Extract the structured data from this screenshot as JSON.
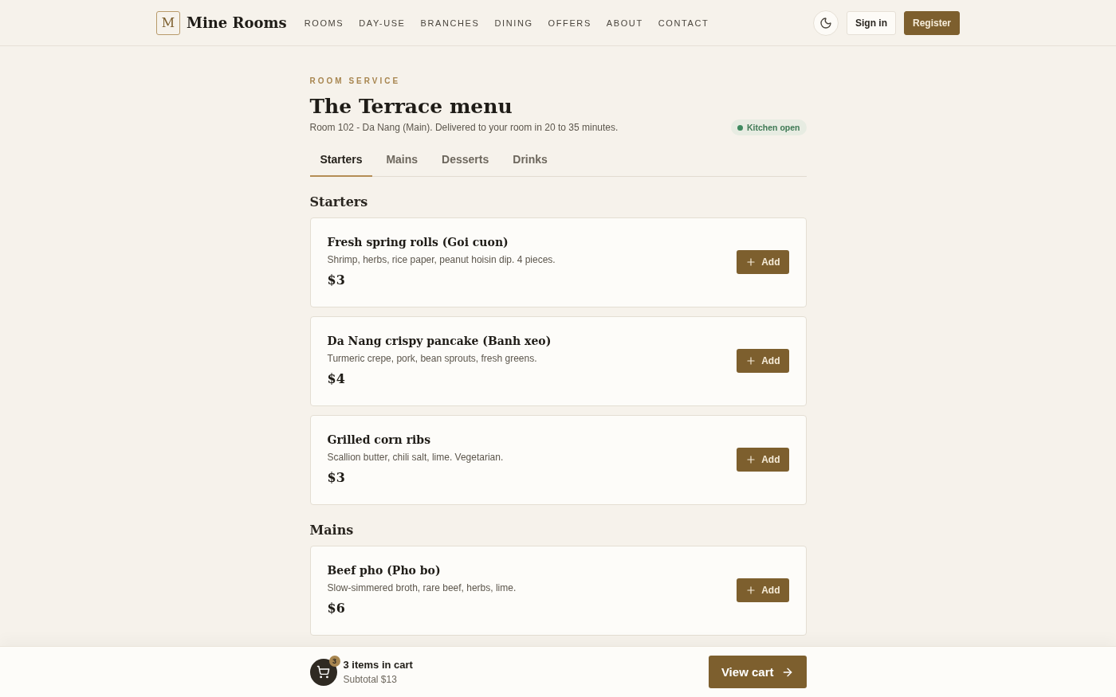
{
  "brand": {
    "mark": "M",
    "name": "Mine Rooms"
  },
  "nav": [
    "ROOMS",
    "DAY-USE",
    "BRANCHES",
    "DINING",
    "OFFERS",
    "ABOUT",
    "CONTACT"
  ],
  "actions": {
    "sign_in": "Sign in",
    "register": "Register"
  },
  "eyebrow": "ROOM SERVICE",
  "title": "The Terrace menu",
  "subtitle": "Room 102 - Da Nang (Main). Delivered to your room in 20 to 35 minutes.",
  "status": {
    "label": "Kitchen open",
    "color": "#3f8a5f"
  },
  "tabs": [
    {
      "label": "Starters",
      "selected": true
    },
    {
      "label": "Mains",
      "selected": false
    },
    {
      "label": "Desserts",
      "selected": false
    },
    {
      "label": "Drinks",
      "selected": false
    }
  ],
  "sections": [
    {
      "heading": "Starters",
      "items": [
        {
          "name": "Fresh spring rolls (Goi cuon)",
          "description": "Shrimp, herbs, rice paper, peanut hoisin dip. 4 pieces.",
          "price": "$3",
          "button": "Add"
        },
        {
          "name": "Da Nang crispy pancake (Banh xeo)",
          "description": "Turmeric crepe, pork, bean sprouts, fresh greens.",
          "price": "$4",
          "button": "Add"
        },
        {
          "name": "Grilled corn ribs",
          "description": "Scallion butter, chili salt, lime. Vegetarian.",
          "price": "$3",
          "button": "Add"
        }
      ]
    },
    {
      "heading": "Mains",
      "items": [
        {
          "name": "Beef pho (Pho bo)",
          "description": "Slow-simmered broth, rare beef, herbs, lime.",
          "price": "$6",
          "button": "Add"
        }
      ]
    }
  ],
  "cart": {
    "count": "3",
    "title": "3 items in cart",
    "subtotal": "Subtotal $13",
    "button": "View cart"
  }
}
